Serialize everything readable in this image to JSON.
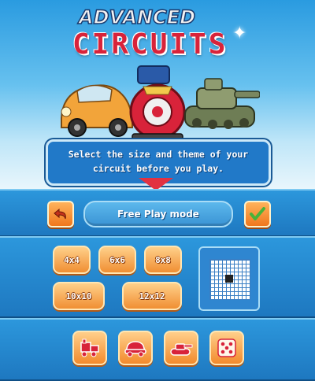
{
  "title": {
    "line1": "ADVANCED",
    "line2": "CIRCUITS"
  },
  "instruction": {
    "line1": "Select the size and theme of your",
    "line2": "circuit before you play."
  },
  "mode": {
    "label": "Free Play mode"
  },
  "sizes": [
    {
      "label": "4x4"
    },
    {
      "label": "6x6"
    },
    {
      "label": "8x8"
    },
    {
      "label": "10x10"
    },
    {
      "label": "12x12"
    }
  ],
  "themes": [
    "train-icon",
    "car-icon",
    "tank-icon",
    "dice-icon"
  ],
  "colors": {
    "accent_orange": "#f08f33",
    "panel_blue": "#1e78c0",
    "title_red": "#d8233a",
    "confirm_green": "#49b33a"
  }
}
